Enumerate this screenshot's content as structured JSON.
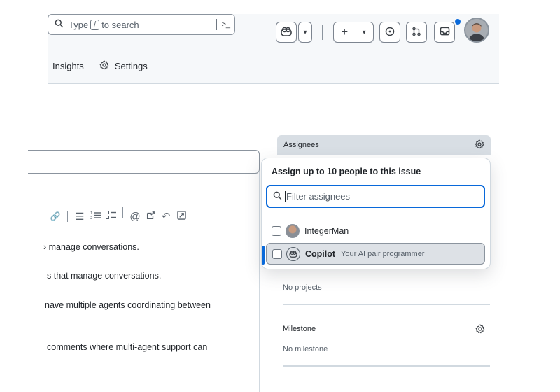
{
  "header": {
    "search": {
      "prefix": "Type",
      "key": "/",
      "suffix": "to search",
      "terminal": ">_"
    },
    "plus": "+",
    "caret": "▾",
    "nav": {
      "insights": "Insights",
      "settings": "Settings"
    }
  },
  "toolbar": {
    "link": "🔗",
    "bullet_list": "☰",
    "numbered_list": "⅟☰",
    "task_list": "☑☰",
    "mention": "@",
    "reference": "⤴",
    "undo": "↶",
    "fullscreen": "⤢"
  },
  "body_lines": [
    "› manage conversations.",
    "s that manage conversations.",
    "nave multiple agents coordinating between",
    "comments where multi-agent support can"
  ],
  "sidebar": {
    "assignees_label": "Assignees",
    "projects_value": "No projects",
    "milestone_label": "Milestone",
    "milestone_value": "No milestone"
  },
  "popover": {
    "title": "Assign up to 10 people to this issue",
    "filter_placeholder": "Filter assignees",
    "users": [
      {
        "name": "IntegerMan",
        "description": ""
      },
      {
        "name": "Copilot",
        "description": "Your AI pair programmer"
      }
    ]
  },
  "colors": {
    "accent": "#0969da",
    "header_bg": "#f6f8fa",
    "notification_dot": "#0969da"
  }
}
